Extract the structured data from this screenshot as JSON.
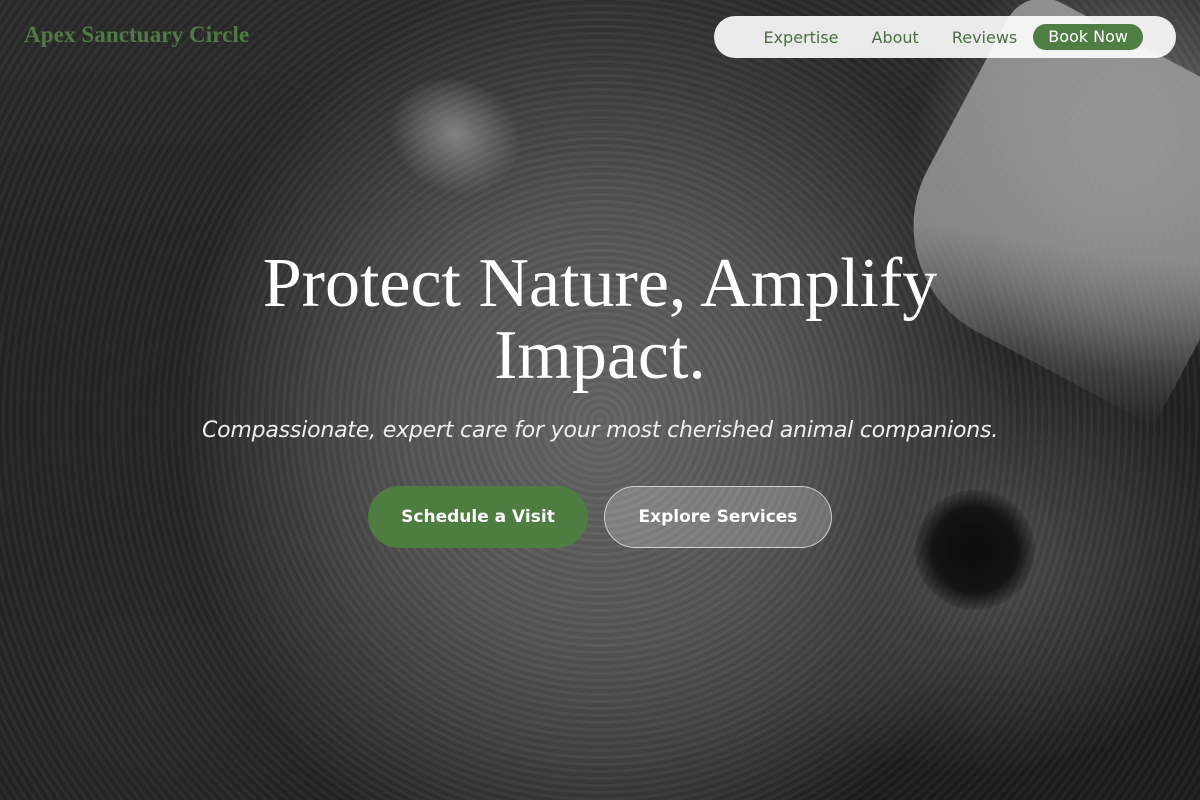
{
  "brand": {
    "name": "Apex Sanctuary Circle",
    "color": "#4f7a44"
  },
  "nav": {
    "items": [
      {
        "label": "Expertise"
      },
      {
        "label": "About"
      },
      {
        "label": "Reviews"
      }
    ],
    "cta_label": "Book Now"
  },
  "hero": {
    "title": "Protect Nature, Amplify Impact.",
    "subtitle": "Compassionate, expert care for your most cherished animal companions.",
    "primary_button": "Schedule a Visit",
    "secondary_button": "Explore Services"
  },
  "colors": {
    "accent": "#4e7c41",
    "nav_text": "#4a7040"
  }
}
